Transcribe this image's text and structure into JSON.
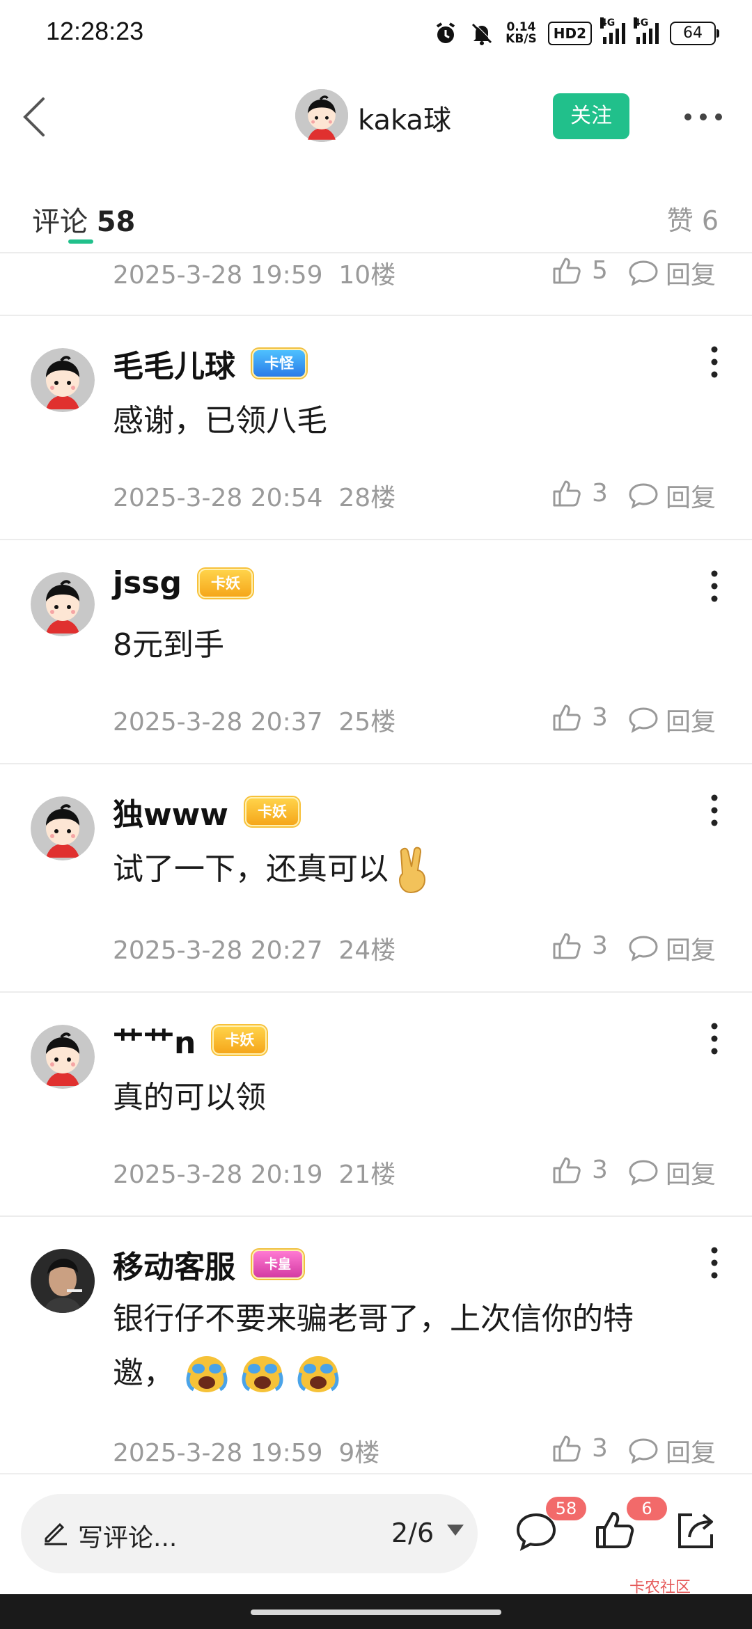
{
  "status_bar": {
    "time": "12:28:23",
    "net_speed_value": "0.14",
    "net_speed_unit": "KB/S",
    "hd_label": "HD2",
    "signal1_label": "4G",
    "signal2_label": "4G",
    "battery": "64"
  },
  "header": {
    "user_name": "kaka球",
    "follow_label": "关注"
  },
  "tabs": {
    "comments_label": "评论",
    "comments_count": "58",
    "likes_label": "赞 6"
  },
  "partial_comment": {
    "time": "2025-3-28 19:59",
    "floor": "10楼",
    "likes": "5",
    "reply_label": "回复"
  },
  "comments": [
    {
      "name": "毛毛儿球",
      "badge": "卡怪",
      "text": "感谢，已领八毛",
      "time": "2025-3-28 20:54",
      "floor": "28楼",
      "likes": "3",
      "reply_label": "回复"
    },
    {
      "name": "jssg",
      "badge": "卡妖",
      "text": "8元到手",
      "time": "2025-3-28 20:37",
      "floor": "25楼",
      "likes": "3",
      "reply_label": "回复"
    },
    {
      "name": "独www",
      "badge": "卡妖",
      "text": "试了一下，还真可以",
      "time": "2025-3-28 20:27",
      "floor": "24楼",
      "likes": "3",
      "reply_label": "回复"
    },
    {
      "name": "艹艹n",
      "badge": "卡妖",
      "text": "真的可以领",
      "time": "2025-3-28 20:19",
      "floor": "21楼",
      "likes": "3",
      "reply_label": "回复"
    },
    {
      "name": "移动客服",
      "badge": "卡皇",
      "text_line1": "银行仔不要来骗老哥了，上次信你的特",
      "text_line2": "邀，",
      "time": "2025-3-28 19:59",
      "floor": "9楼",
      "likes": "3",
      "reply_label": "回复"
    }
  ],
  "bottom_bar": {
    "write_label": "写评论...",
    "page_indicator": "2/6",
    "comment_count": "58",
    "like_count": "6"
  },
  "watermark": {
    "text": "卡农社区"
  },
  "colors": {
    "accent_green": "#21c08b",
    "badge_red": "#f26a6a",
    "meta_gray": "#9a9a9a"
  },
  "icons": [
    "back-icon",
    "more-horizontal-icon",
    "more-vertical-icon",
    "thumbs-up-icon",
    "comment-icon",
    "edit-icon",
    "share-icon",
    "caret-down-icon",
    "victory-hand-emoji",
    "crying-emoji"
  ]
}
